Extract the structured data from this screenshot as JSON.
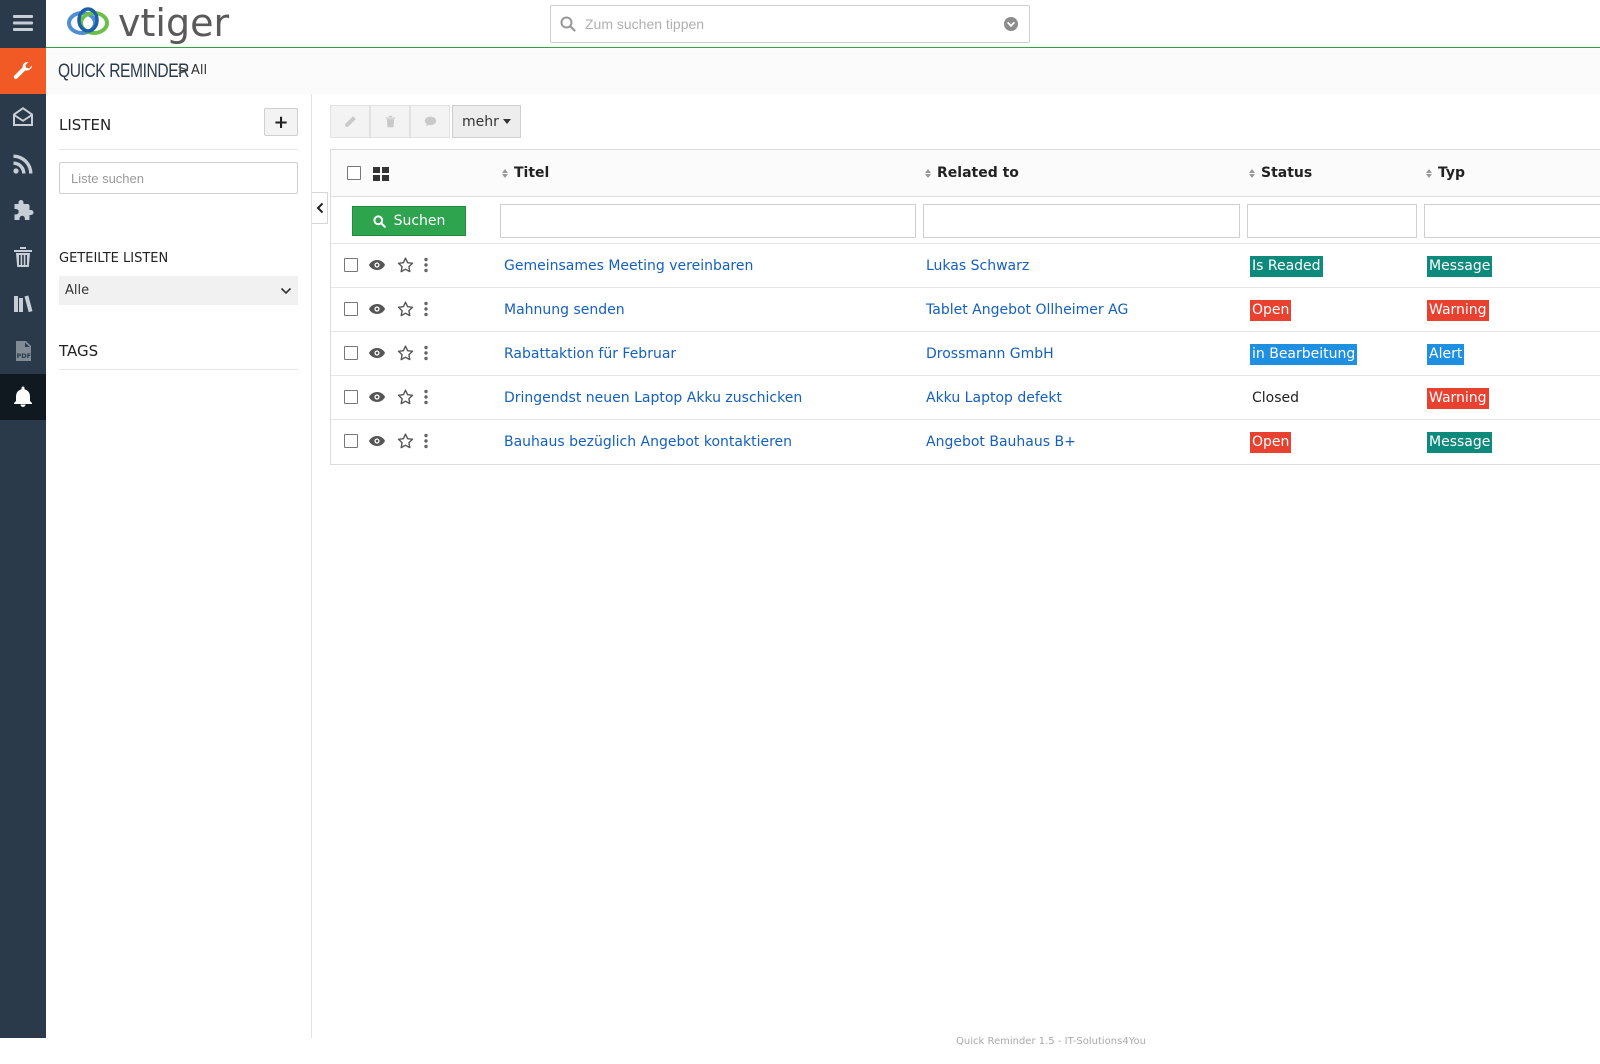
{
  "app": {
    "logo_text": "vtiger"
  },
  "search": {
    "placeholder": "Zum suchen tippen"
  },
  "breadcrumb": {
    "module": "QUICK REMINDER",
    "separator": ">",
    "view": "All"
  },
  "sidebar": {
    "lists_heading": "LISTEN",
    "add_label": "+",
    "list_search_placeholder": "Liste suchen",
    "shared_heading": "GETEILTE LISTEN",
    "shared_selected": "Alle",
    "tags_heading": "TAGS"
  },
  "rail_icons": [
    "menu-icon",
    "wrench-icon",
    "mail-icon",
    "rss-icon",
    "puzzle-icon",
    "trash-icon",
    "library-icon",
    "pdf-icon",
    "bell-icon"
  ],
  "toolbar": {
    "more_label": "mehr"
  },
  "table": {
    "columns": [
      "Titel",
      "Related to",
      "Status",
      "Typ"
    ],
    "search_button": "Suchen",
    "rows": [
      {
        "title": "Gemeinsames Meeting vereinbaren",
        "related": "Lukas Schwarz",
        "status": "Is Readed",
        "status_color": "#0e8a7d",
        "type": "Message",
        "type_color": "#0e8a7d"
      },
      {
        "title": "Mahnung senden",
        "related": "Tablet Angebot Ollheimer AG",
        "status": "Open",
        "status_color": "#e8412f",
        "type": "Warning",
        "type_color": "#e8412f"
      },
      {
        "title": "Rabattaktion für Februar",
        "related": "Drossmann GmbH",
        "status": "in Bearbeitung",
        "status_color": "#1e8fe1",
        "type": "Alert",
        "type_color": "#1e8fe1"
      },
      {
        "title": "Dringendst neuen Laptop Akku zuschicken",
        "related": "Akku Laptop defekt",
        "status": "Closed",
        "status_color": "",
        "type": "Warning",
        "type_color": "#e8412f"
      },
      {
        "title": "Bauhaus bezüglich Angebot kontaktieren",
        "related": "Angebot Bauhaus B+",
        "status": "Open",
        "status_color": "#e8412f",
        "type": "Message",
        "type_color": "#0e8a7d"
      }
    ]
  },
  "colors": {
    "accent_orange": "#f15a24",
    "rail_bg": "#2b3a4a",
    "link": "#1560bd",
    "green": "#2ea44f"
  },
  "footer": {
    "text": "Quick Reminder 1.5 - IT-Solutions4You"
  }
}
